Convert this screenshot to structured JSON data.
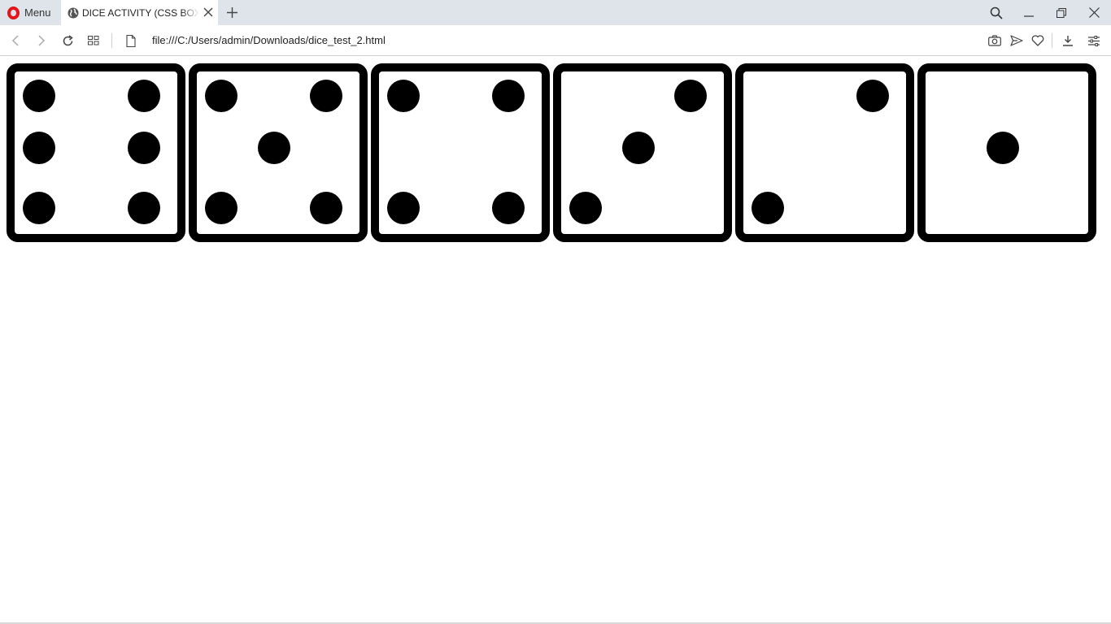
{
  "browser": {
    "menu_label": "Menu",
    "tab_title": "DICE ACTIVITY (CSS BOX MODEL)",
    "url": "file:///C:/Users/admin/Downloads/dice_test_2.html",
    "accent_color": "#e4161b"
  },
  "icons": {
    "tab": [
      "globe-icon",
      "close-icon",
      "plus-icon"
    ],
    "window": [
      "search-icon",
      "minimize-icon",
      "restore-icon",
      "close-icon"
    ],
    "toolbar": [
      "back-icon",
      "forward-icon",
      "reload-icon",
      "tabs-grid-icon",
      "page-icon",
      "camera-icon",
      "send-icon",
      "heart-icon",
      "download-icon",
      "settings-icon"
    ]
  },
  "dice": [
    {
      "value": 6,
      "pips": [
        "tl",
        "tr",
        "ml",
        "mr",
        "bl",
        "br"
      ]
    },
    {
      "value": 5,
      "pips": [
        "tl",
        "tr",
        "c",
        "bl",
        "br"
      ]
    },
    {
      "value": 4,
      "pips": [
        "tl",
        "tr",
        "bl",
        "br"
      ]
    },
    {
      "value": 3,
      "pips": [
        "tr",
        "c",
        "bl"
      ]
    },
    {
      "value": 2,
      "pips": [
        "tr",
        "bl"
      ]
    },
    {
      "value": 1,
      "pips": [
        "c"
      ]
    }
  ]
}
